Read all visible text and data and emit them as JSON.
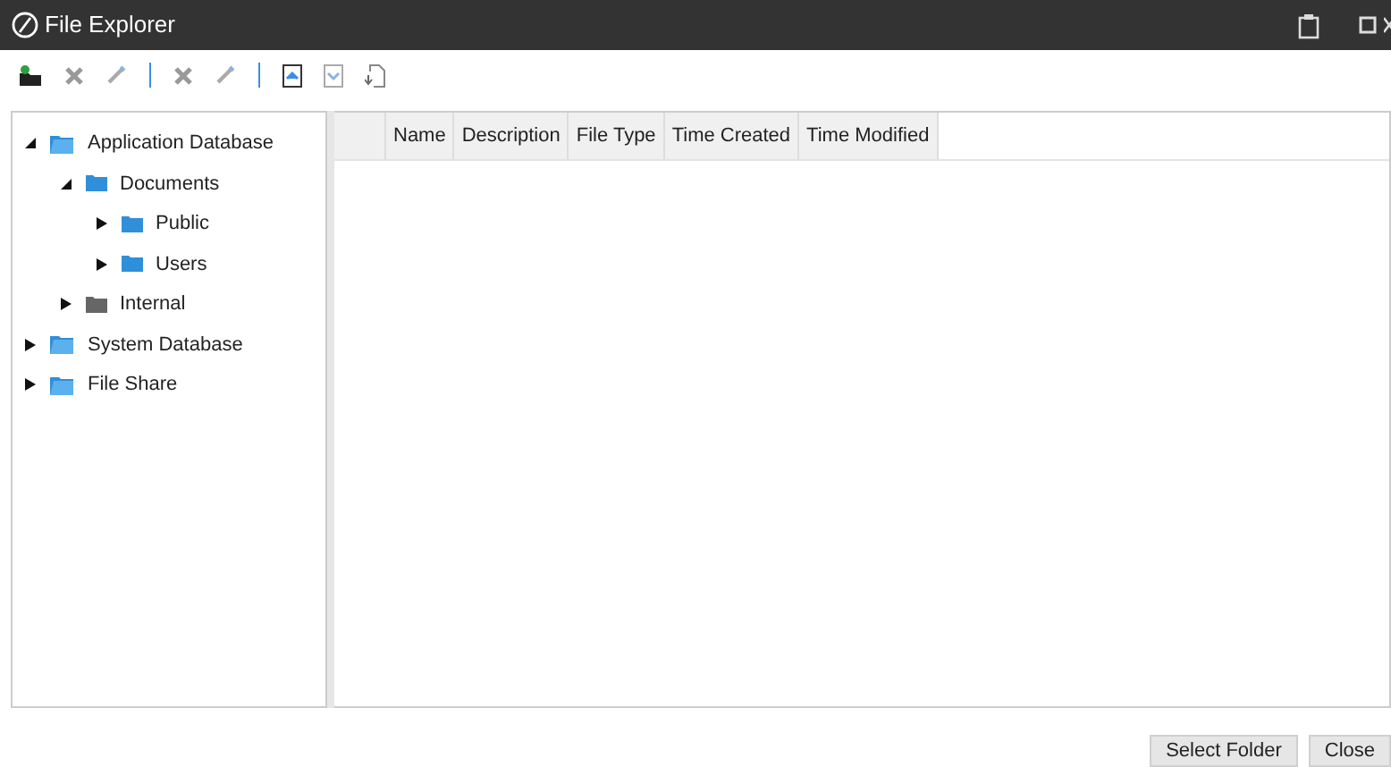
{
  "window": {
    "title": "File Explorer"
  },
  "toolbar": [
    {
      "kind": "new-folder"
    },
    {
      "kind": "delete"
    },
    {
      "kind": "edit"
    },
    {
      "kind": "separator"
    },
    {
      "kind": "delete"
    },
    {
      "kind": "edit"
    },
    {
      "kind": "separator"
    },
    {
      "kind": "upload"
    },
    {
      "kind": "download"
    },
    {
      "kind": "export"
    }
  ],
  "tree": [
    {
      "label": "Application Database",
      "kind": "database",
      "expanded": true,
      "children": [
        {
          "label": "Documents",
          "kind": "folder",
          "color": "#2f8fd8",
          "expanded": true,
          "children": [
            {
              "label": "Public",
              "kind": "folder",
              "color": "#2f8fd8",
              "expanded": false
            },
            {
              "label": "Users",
              "kind": "folder",
              "color": "#2f8fd8",
              "expanded": false
            }
          ]
        },
        {
          "label": "Internal",
          "kind": "folder",
          "color": "#666666",
          "expanded": false
        }
      ]
    },
    {
      "label": "System Database",
      "kind": "database",
      "expanded": false
    },
    {
      "label": "File Share",
      "kind": "database",
      "expanded": false
    }
  ],
  "table": {
    "columns": [
      "Name",
      "Description",
      "File Type",
      "Time Created",
      "Time Modified"
    ]
  },
  "buttons": [
    "Select Folder",
    "Close"
  ]
}
